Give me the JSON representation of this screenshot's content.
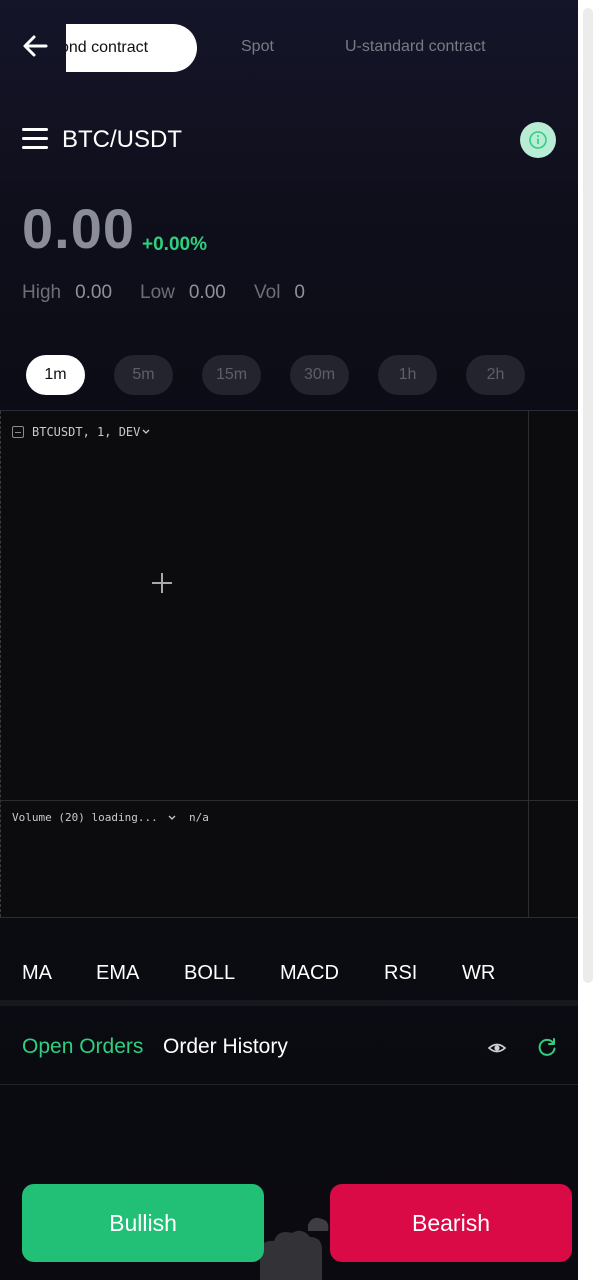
{
  "header": {
    "tabs": [
      {
        "label": "cond contract",
        "active": true
      },
      {
        "label": "Spot",
        "active": false
      },
      {
        "label": "U-standard contract",
        "active": false
      }
    ]
  },
  "pair": {
    "symbol": "BTC/USDT"
  },
  "ticker": {
    "price": "0.00",
    "change": "+0.00%",
    "high_label": "High",
    "high_value": "0.00",
    "low_label": "Low",
    "low_value": "0.00",
    "vol_label": "Vol",
    "vol_value": "0"
  },
  "intervals": [
    "1m",
    "5m",
    "15m",
    "30m",
    "1h",
    "2h"
  ],
  "chart": {
    "legend": "BTCUSDT, 1, DEV",
    "volume_legend": "Volume (20) loading...",
    "volume_value": "n/a"
  },
  "indicators": [
    "MA",
    "EMA",
    "BOLL",
    "MACD",
    "RSI",
    "WR"
  ],
  "orders": {
    "open_label": "Open Orders",
    "history_label": "Order History"
  },
  "actions": {
    "bullish": "Bullish",
    "bearish": "Bearish"
  },
  "colors": {
    "accent_green": "#22c077",
    "accent_red": "#d90a46",
    "up_text": "#2fcf7f"
  }
}
